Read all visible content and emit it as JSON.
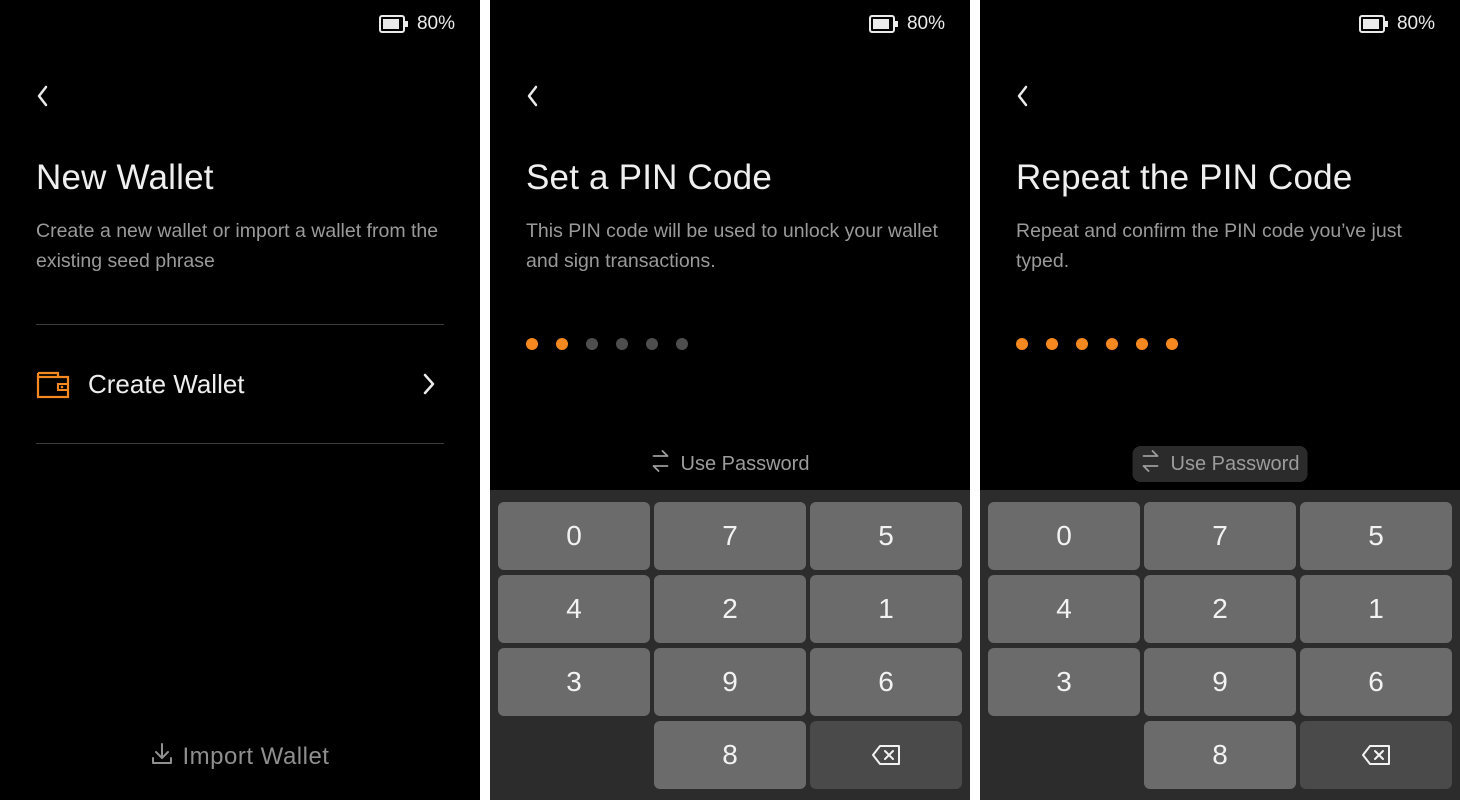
{
  "screens": [
    {
      "status": {
        "battery_text": "80%"
      },
      "title": "New Wallet",
      "subtitle": "Create a new wallet or import a wallet from the existing seed phrase",
      "menu": {
        "create_label": "Create Wallet",
        "icon": "wallet-icon"
      },
      "import_label": "Import Wallet"
    },
    {
      "status": {
        "battery_text": "80%"
      },
      "title": "Set a PIN Code",
      "subtitle": "This PIN code will be used to unlock your wallet and sign transactions.",
      "pin": {
        "length": 6,
        "filled": 2
      },
      "use_password_label": "Use Password",
      "keys": [
        "0",
        "7",
        "5",
        "4",
        "2",
        "1",
        "3",
        "9",
        "6",
        "8"
      ]
    },
    {
      "status": {
        "battery_text": "80%"
      },
      "title": "Repeat the PIN Code",
      "subtitle": "Repeat and confirm the PIN code you’ve just typed.",
      "pin": {
        "length": 6,
        "filled": 6
      },
      "use_password_label": "Use Password",
      "keys": [
        "0",
        "7",
        "5",
        "4",
        "2",
        "1",
        "3",
        "9",
        "6",
        "8"
      ]
    }
  ],
  "colors": {
    "accent": "#f5891f",
    "background": "#000000",
    "key": "#6b6b6b",
    "keypad_bg": "#2c2c2c"
  }
}
